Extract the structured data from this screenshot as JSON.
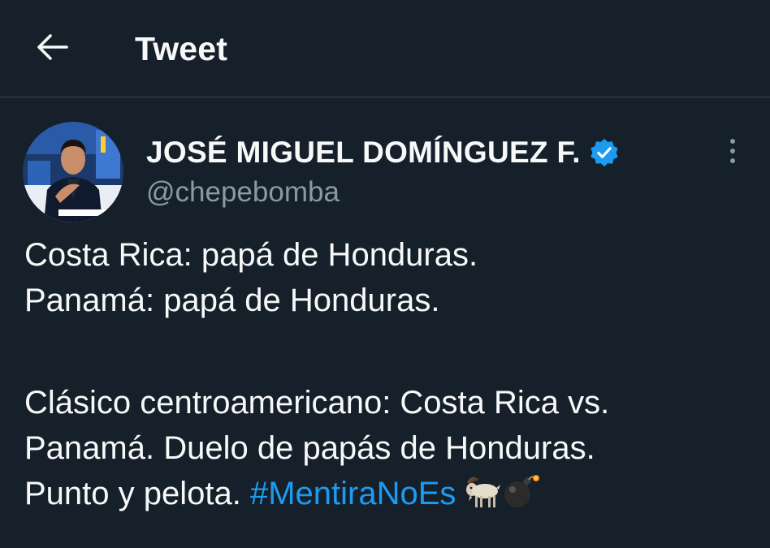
{
  "header": {
    "title": "Tweet",
    "back_icon": "arrow-left-icon"
  },
  "author": {
    "name": "JOSÉ MIGUEL DOMÍNGUEZ F.",
    "handle": "@chepebomba",
    "verified_icon": "verified-badge-icon",
    "more_icon": "more-vertical-icon"
  },
  "tweet": {
    "line1": "Costa Rica: papá de Honduras.",
    "line2": "Panamá: papá de Honduras.",
    "line3": "Clásico centroamericano: Costa Rica vs.",
    "line4": "Panamá. Duelo de papás de Honduras.",
    "line5": "Punto y pelota.",
    "hashtag": "#MentiraNoEs",
    "emojis": [
      "goat-emoji",
      "bomb-emoji"
    ]
  },
  "colors": {
    "background": "#15202b",
    "text": "#f7f9f9",
    "secondary_text": "#8b98a5",
    "accent": "#1d9bf0",
    "divider": "#38444d"
  }
}
